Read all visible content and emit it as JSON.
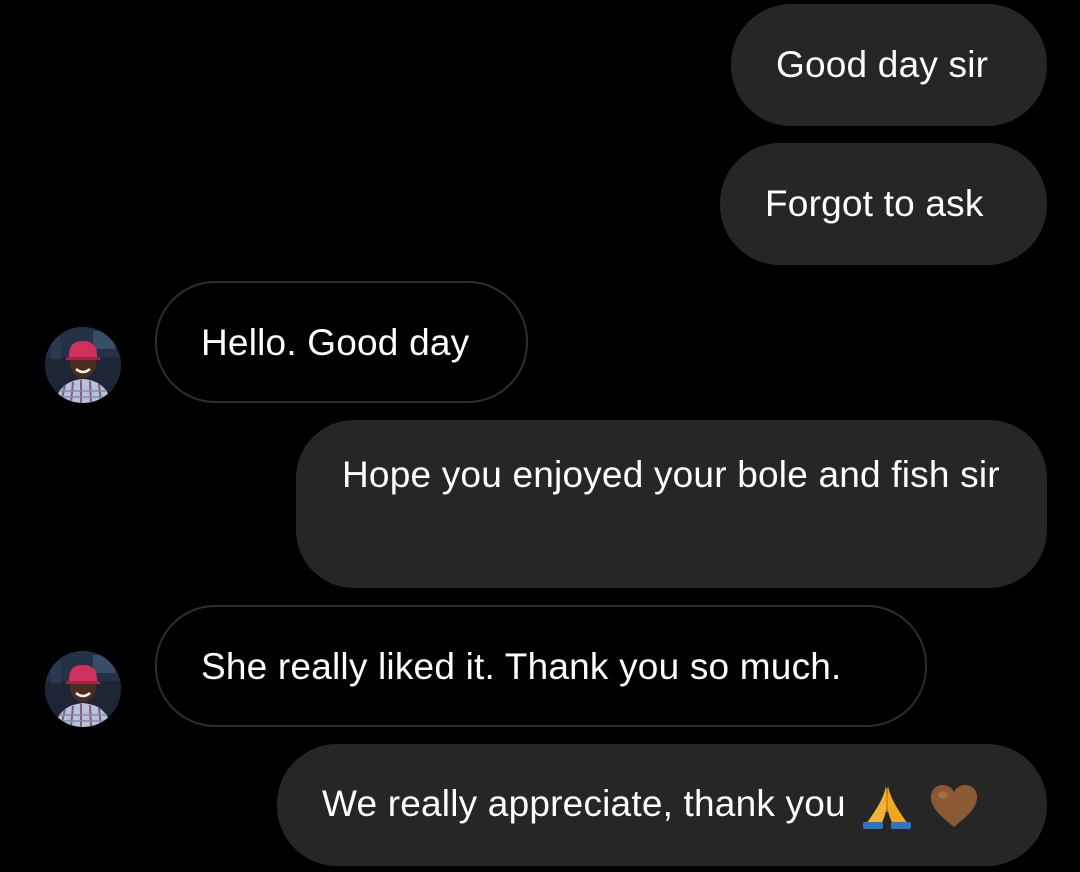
{
  "colors": {
    "background": "#000000",
    "sent_bubble": "#262626",
    "received_border": "#2e2e2e",
    "text": "#ffffff"
  },
  "messages": [
    {
      "direction": "sent",
      "text": "Good day sir"
    },
    {
      "direction": "sent",
      "text": "Forgot to ask"
    },
    {
      "direction": "received",
      "text": "Hello. Good day",
      "avatar": "contact-avatar"
    },
    {
      "direction": "sent",
      "text": "Hope you enjoyed your bole and fish sir"
    },
    {
      "direction": "received",
      "text": "She really liked it. Thank you so much.",
      "avatar": "contact-avatar"
    },
    {
      "direction": "sent",
      "text": "We really appreciate, thank you",
      "emojis": [
        "folded-hands-icon",
        "brown-heart-icon"
      ]
    }
  ]
}
